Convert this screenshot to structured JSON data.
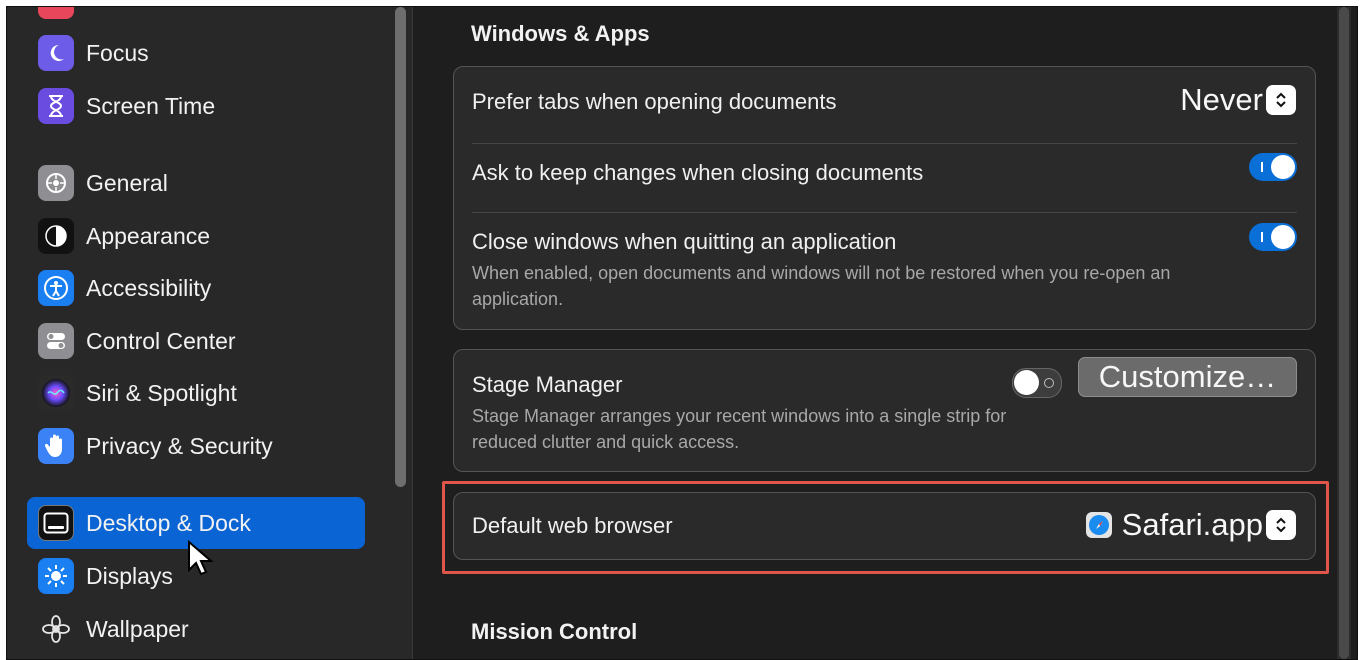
{
  "sidebar": {
    "items": [
      {
        "label": "Focus",
        "icon": "moon-icon",
        "color": "#6c5ce7"
      },
      {
        "label": "Screen Time",
        "icon": "hourglass-icon",
        "color": "#6a4ce0"
      },
      {
        "label": "General",
        "icon": "gear-icon",
        "color": "#8e8e93"
      },
      {
        "label": "Appearance",
        "icon": "appearance-icon",
        "color": "#1c1c1e"
      },
      {
        "label": "Accessibility",
        "icon": "accessibility-icon",
        "color": "#1a7ff0"
      },
      {
        "label": "Control Center",
        "icon": "control-center-icon",
        "color": "#8e8e93"
      },
      {
        "label": "Siri & Spotlight",
        "icon": "siri-icon",
        "color": "#2a2a2a"
      },
      {
        "label": "Privacy & Security",
        "icon": "hand-icon",
        "color": "#3b82f6"
      },
      {
        "label": "Desktop & Dock",
        "icon": "dock-icon",
        "color": "#1c1c1e",
        "selected": true
      },
      {
        "label": "Displays",
        "icon": "sun-icon",
        "color": "#1a7ff0"
      },
      {
        "label": "Wallpaper",
        "icon": "flower-icon",
        "color": "#2a2a2a"
      }
    ]
  },
  "windows_apps": {
    "title": "Windows & Apps",
    "prefer_tabs": {
      "label": "Prefer tabs when opening documents",
      "value": "Never"
    },
    "ask_keep": {
      "label": "Ask to keep changes when closing documents",
      "enabled": true
    },
    "close_windows": {
      "label": "Close windows when quitting an application",
      "description": "When enabled, open documents and windows will not be restored when you re-open an application.",
      "enabled": true
    }
  },
  "stage_manager": {
    "label": "Stage Manager",
    "description": "Stage Manager arranges your recent windows into a single strip for reduced clutter and quick access.",
    "enabled": false,
    "customize_label": "Customize…"
  },
  "default_browser": {
    "label": "Default web browser",
    "value": "Safari.app"
  },
  "mission_control": {
    "title": "Mission Control"
  },
  "colors": {
    "accent": "#0a64d3",
    "highlight": "#e0554a"
  }
}
